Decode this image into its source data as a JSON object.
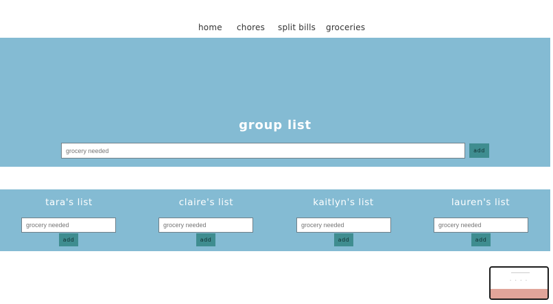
{
  "nav": {
    "items": [
      {
        "label": "home"
      },
      {
        "label": "chores"
      },
      {
        "label": "split bills"
      },
      {
        "label": "groceries"
      }
    ]
  },
  "group": {
    "title": "group list",
    "input_placeholder": "grocery needed",
    "add_label": "add"
  },
  "lists": [
    {
      "title": "tara's list",
      "input_placeholder": "grocery needed",
      "add_label": "add"
    },
    {
      "title": "claire's list",
      "input_placeholder": "grocery needed",
      "add_label": "add"
    },
    {
      "title": "kaitlyn's list",
      "input_placeholder": "grocery needed",
      "add_label": "add"
    },
    {
      "title": "lauren's list",
      "input_placeholder": "grocery needed",
      "add_label": "add"
    }
  ],
  "colors": {
    "band": "#84bbd3",
    "button": "#3f8d90",
    "thumbnail_strip": "#e1a59a"
  }
}
